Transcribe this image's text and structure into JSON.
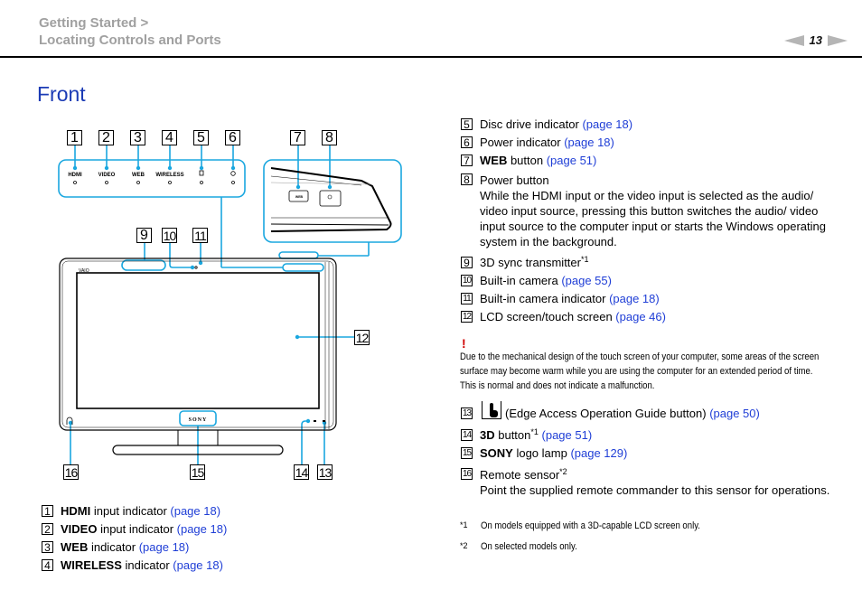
{
  "breadcrumb": {
    "line1": "Getting Started >",
    "line2": "Locating Controls and Ports"
  },
  "pager": {
    "page": "13",
    "prev_icon": "triangle-left-icon",
    "next_icon": "triangle-right-icon"
  },
  "title": "Front",
  "colors": {
    "accent_line": "#1aa7df",
    "title": "#1b3bb5",
    "link": "#1f3ed6",
    "warning": "#d00000",
    "breadcrumb": "#a0a0a0"
  },
  "figure": {
    "callouts": [
      "1",
      "2",
      "3",
      "4",
      "5",
      "6",
      "7",
      "8",
      "9",
      "10",
      "11",
      "12",
      "13",
      "14",
      "15",
      "16"
    ],
    "indicator_labels": [
      "HDMI",
      "VIDEO",
      "WEB",
      "WIRELESS",
      "disc-icon",
      "power-icon"
    ],
    "web_button_label": "WEB",
    "logo_text": "SONY",
    "vaio_text": "VAIO"
  },
  "left_list": [
    {
      "num": "1",
      "bold": "HDMI",
      "text": " input indicator ",
      "link": "(page 18)"
    },
    {
      "num": "2",
      "bold": "VIDEO",
      "text": " input indicator ",
      "link": "(page 18)"
    },
    {
      "num": "3",
      "bold": "WEB",
      "text": " indicator ",
      "link": "(page 18)"
    },
    {
      "num": "4",
      "bold": "WIRELESS",
      "text": " indicator ",
      "link": "(page 18)"
    }
  ],
  "right_list": [
    {
      "num": "5",
      "text": "Disc drive indicator ",
      "link": "(page 18)"
    },
    {
      "num": "6",
      "text": "Power indicator ",
      "link": "(page 18)"
    },
    {
      "num": "7",
      "bold": "WEB",
      "text": " button ",
      "link": "(page 51)"
    },
    {
      "num": "8",
      "text": "Power button",
      "desc": "While the HDMI input or the video input is selected as the audio/ video input source, pressing this button switches the audio/ video input source to the computer input or starts the Windows operating system in the background."
    },
    {
      "num": "9",
      "text": "3D sync transmitter",
      "sup": "*1"
    },
    {
      "num": "10",
      "text": "Built-in camera ",
      "link": "(page 55)"
    },
    {
      "num": "11",
      "text": "Built-in camera indicator ",
      "link": "(page 18)"
    },
    {
      "num": "12",
      "text": "LCD screen/touch screen ",
      "link": "(page 46)"
    }
  ],
  "warning": {
    "mark": "!",
    "text": "Due to the mechanical design of the touch screen of your computer, some areas of the screen surface may become warm while you are using the computer for an extended period of time. This is normal and does not indicate a malfunction."
  },
  "right_list2": [
    {
      "num": "13",
      "icon": "edge-access-icon",
      "text": " (Edge Access Operation Guide button) ",
      "link": "(page 50)"
    },
    {
      "num": "14",
      "bold": "3D",
      "text": " button",
      "sup": "*1",
      "link": " (page 51)"
    },
    {
      "num": "15",
      "bold": "SONY",
      "text": " logo lamp ",
      "link": "(page 129)"
    },
    {
      "num": "16",
      "text": "Remote sensor",
      "sup": "*2",
      "desc": "Point the supplied remote commander to this sensor for operations."
    }
  ],
  "footnotes": [
    {
      "mark": "*1",
      "text": "On models equipped with a 3D-capable LCD screen only."
    },
    {
      "mark": "*2",
      "text": "On selected models only."
    }
  ]
}
